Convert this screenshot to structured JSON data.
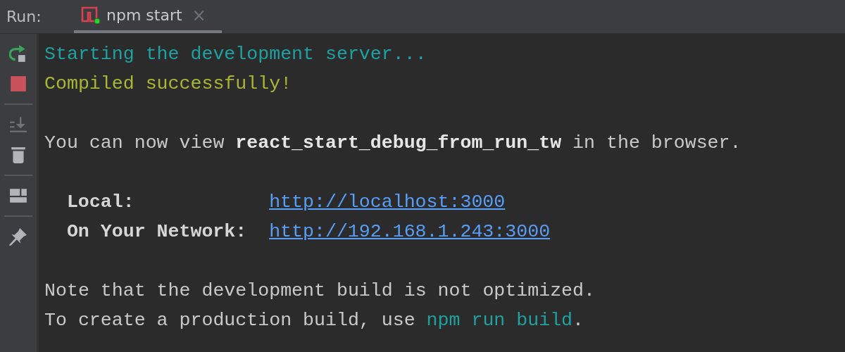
{
  "header": {
    "label": "Run:",
    "tabs": [
      {
        "label": "npm start",
        "close": "×",
        "selected": true,
        "running": true
      }
    ]
  },
  "toolbar": [
    [
      {
        "kind": "rerun",
        "disabled": false
      },
      {
        "kind": "stop",
        "disabled": false
      }
    ],
    [
      {
        "kind": "scroll-end",
        "disabled": true
      },
      {
        "kind": "trash",
        "disabled": false
      }
    ],
    [
      {
        "kind": "layout",
        "disabled": false
      }
    ],
    [
      {
        "kind": "pin",
        "disabled": false
      }
    ]
  ],
  "console": [
    [
      {
        "kind": "text",
        "segments": [
          {
            "kind": "info",
            "text": "Starting the development server..."
          }
        ]
      },
      {
        "kind": "text",
        "segments": [
          {
            "kind": "success",
            "text": "Compiled successfully!"
          }
        ]
      }
    ],
    [
      {
        "kind": "text",
        "segments": [
          {
            "kind": "plain",
            "text": "You can now view **react_start_debug_from_run_tw** in the browser."
          }
        ]
      }
    ],
    [
      {
        "kind": "address",
        "label": "Local:",
        "url": "http://localhost:3000"
      },
      {
        "kind": "address",
        "label": "On Your Network:",
        "url": "http://192.168.1.243:3000"
      }
    ],
    [
      {
        "kind": "text",
        "segments": [
          {
            "kind": "plain",
            "text": "Note that the development build is not optimized."
          }
        ]
      },
      {
        "kind": "text",
        "segments": [
          {
            "kind": "plain",
            "text": "To create a production build, use "
          },
          {
            "kind": "command",
            "text": "npm run build"
          },
          {
            "kind": "plain",
            "text": "."
          }
        ]
      }
    ]
  ]
}
